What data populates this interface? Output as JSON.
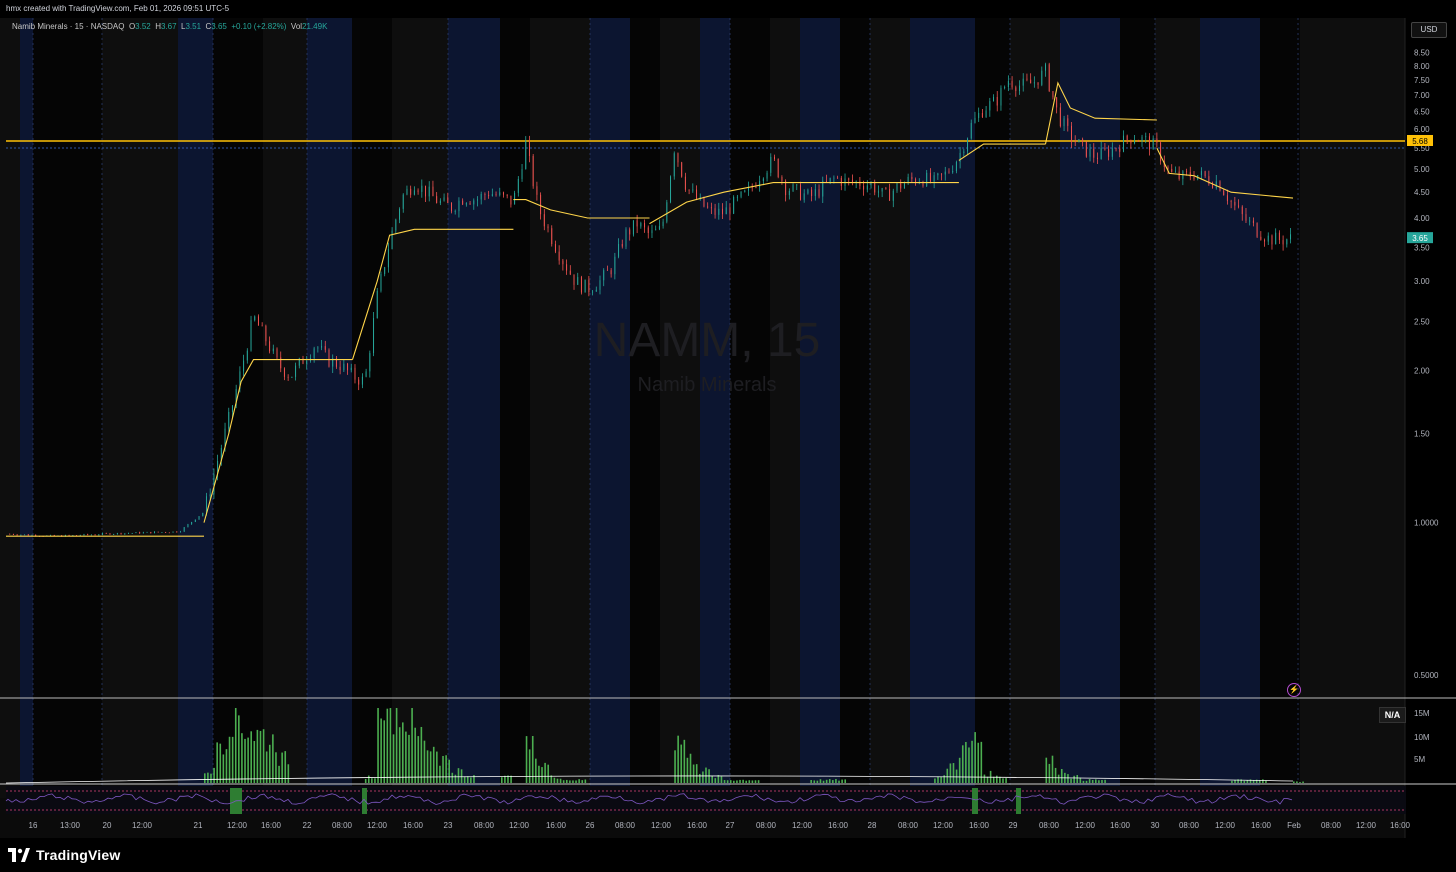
{
  "header": {
    "caption": "hmx created with TradingView.com, Feb 01, 2026 09:51 UTC-5"
  },
  "legend": {
    "symbol": "Namib Minerals · 15 · NASDAQ",
    "o_label": "O",
    "o": "3.52",
    "h_label": "H",
    "h": "3.67",
    "l_label": "L",
    "l": "3.51",
    "c_label": "C",
    "c": "3.65",
    "change": "+0.10 (+2.82%)",
    "vol_label": "Vol",
    "vol": "21.49K"
  },
  "currency_button": "USD",
  "watermark": {
    "ticker": "NAMM, 15",
    "name": "Namib Minerals"
  },
  "price_badges": {
    "level": "5.68",
    "last": "3.65"
  },
  "volume_badge": "N/A",
  "brand": {
    "name": "TradingView"
  },
  "colors": {
    "up": "#26a69a",
    "down": "#ef5350",
    "vwap": "#ffd54a",
    "level_line": "#ffc107",
    "last_badge": "#26a69a",
    "volume": "#4caf50",
    "session_blue": "#0c1530",
    "indicator": "#7e57c2"
  },
  "chart_data": {
    "type": "candlestick",
    "title": "Namib Minerals · 15 · NASDAQ",
    "y_scale": "log",
    "ylim": [
      0.45,
      9.5
    ],
    "y_ticks": [
      "8.50",
      "8.00",
      "7.50",
      "7.00",
      "6.50",
      "6.00",
      "5.50",
      "5.00",
      "4.50",
      "4.00",
      "3.50",
      "3.00",
      "2.50",
      "2.00",
      "1.50",
      "1.0000",
      "0.5000"
    ],
    "x_ticks": [
      "16",
      "13:00",
      "20",
      "12:00",
      "21",
      "12:00",
      "16:00",
      "22",
      "08:00",
      "12:00",
      "16:00",
      "23",
      "08:00",
      "12:00",
      "16:00",
      "26",
      "08:00",
      "12:00",
      "16:00",
      "27",
      "08:00",
      "12:00",
      "16:00",
      "28",
      "08:00",
      "12:00",
      "16:00",
      "29",
      "08:00",
      "12:00",
      "16:00",
      "30",
      "08:00",
      "12:00",
      "16:00",
      "Feb",
      "08:00",
      "12:00",
      "16:00"
    ],
    "horizontal_level": 5.68,
    "last_price": 3.65,
    "price_path": [
      [
        0,
        0.95
      ],
      [
        4,
        0.94
      ],
      [
        8,
        0.95
      ],
      [
        14,
        0.96
      ],
      [
        16,
        1.05
      ],
      [
        17,
        1.3
      ],
      [
        18,
        1.6
      ],
      [
        19,
        2.0
      ],
      [
        20,
        2.55
      ],
      [
        21,
        2.3
      ],
      [
        22,
        2.05
      ],
      [
        23,
        1.95
      ],
      [
        24,
        2.1
      ],
      [
        25,
        2.25
      ],
      [
        26,
        2.1
      ],
      [
        27,
        2.05
      ],
      [
        28,
        1.95
      ],
      [
        29,
        1.9
      ],
      [
        30,
        2.8
      ],
      [
        31,
        3.6
      ],
      [
        32,
        4.4
      ],
      [
        33,
        4.7
      ],
      [
        34,
        4.5
      ],
      [
        35,
        4.3
      ],
      [
        36,
        4.2
      ],
      [
        37,
        4.4
      ],
      [
        38,
        4.35
      ],
      [
        39,
        4.5
      ],
      [
        40,
        4.4
      ],
      [
        41,
        4.3
      ],
      [
        42,
        5.6
      ],
      [
        43,
        4.2
      ],
      [
        44,
        3.7
      ],
      [
        45,
        3.3
      ],
      [
        46,
        3.0
      ],
      [
        47,
        2.9
      ],
      [
        48,
        3.0
      ],
      [
        49,
        3.2
      ],
      [
        50,
        3.7
      ],
      [
        51,
        3.9
      ],
      [
        52,
        3.7
      ],
      [
        53,
        3.8
      ],
      [
        54,
        5.5
      ],
      [
        55,
        4.6
      ],
      [
        56,
        4.3
      ],
      [
        57,
        4.1
      ],
      [
        58,
        4.1
      ],
      [
        59,
        4.3
      ],
      [
        60,
        4.5
      ],
      [
        61,
        4.9
      ],
      [
        62,
        5.2
      ],
      [
        63,
        4.6
      ],
      [
        64,
        4.5
      ],
      [
        65,
        4.4
      ],
      [
        66,
        4.6
      ],
      [
        67,
        4.8
      ],
      [
        68,
        4.7
      ],
      [
        69,
        4.7
      ],
      [
        70,
        4.65
      ],
      [
        71,
        4.4
      ],
      [
        72,
        4.6
      ],
      [
        73,
        4.75
      ],
      [
        74,
        4.8
      ],
      [
        75,
        4.7
      ],
      [
        76,
        4.9
      ],
      [
        77,
        5.3
      ],
      [
        78,
        6.1
      ],
      [
        79,
        6.6
      ],
      [
        80,
        6.8
      ],
      [
        81,
        7.5
      ],
      [
        82,
        7.3
      ],
      [
        83,
        7.4
      ],
      [
        84,
        7.8
      ],
      [
        85,
        6.4
      ],
      [
        86,
        5.8
      ],
      [
        87,
        5.5
      ],
      [
        88,
        5.3
      ],
      [
        89,
        5.4
      ],
      [
        90,
        5.6
      ],
      [
        91,
        5.8
      ],
      [
        92,
        5.7
      ],
      [
        93,
        5.5
      ],
      [
        94,
        4.9
      ],
      [
        95,
        4.8
      ],
      [
        96,
        4.9
      ],
      [
        97,
        4.8
      ],
      [
        98,
        4.7
      ],
      [
        99,
        4.3
      ],
      [
        100,
        4.0
      ],
      [
        101,
        3.8
      ],
      [
        102,
        3.65
      ],
      [
        103,
        3.62
      ],
      [
        104,
        3.65
      ]
    ],
    "vwap_segments": [
      [
        [
          0,
          0.94
        ],
        [
          16,
          0.94
        ]
      ],
      [
        [
          16,
          1.0
        ],
        [
          18,
          1.5
        ],
        [
          19,
          1.9
        ],
        [
          20,
          2.1
        ],
        [
          28,
          2.1
        ]
      ],
      [
        [
          28,
          2.1
        ],
        [
          30,
          3.0
        ],
        [
          31,
          3.7
        ],
        [
          33,
          3.8
        ],
        [
          41,
          3.8
        ]
      ],
      [
        [
          41,
          4.35
        ],
        [
          42,
          4.35
        ],
        [
          44,
          4.15
        ],
        [
          47,
          4.0
        ],
        [
          52,
          4.0
        ]
      ],
      [
        [
          52,
          3.9
        ],
        [
          55,
          4.3
        ],
        [
          58,
          4.5
        ],
        [
          62,
          4.7
        ],
        [
          77,
          4.7
        ]
      ],
      [
        [
          77,
          5.2
        ],
        [
          79,
          5.6
        ],
        [
          84,
          5.6
        ]
      ],
      [
        [
          84,
          5.6
        ],
        [
          85,
          7.4
        ],
        [
          86,
          6.6
        ],
        [
          88,
          6.3
        ],
        [
          93,
          6.25
        ]
      ],
      [
        [
          93,
          5.5
        ],
        [
          94,
          4.9
        ],
        [
          96,
          4.85
        ],
        [
          99,
          4.5
        ],
        [
          104,
          4.38
        ]
      ]
    ],
    "volume_series": {
      "name": "Volume",
      "values": [
        0,
        0,
        0,
        0,
        0,
        0,
        0,
        0,
        0,
        0,
        0,
        0,
        0,
        0,
        0,
        0,
        0.2,
        0.7,
        1.1,
        0.9,
        0.8,
        0.7,
        0.4,
        0,
        0,
        0,
        0,
        0,
        0,
        0.1,
        1.5,
        1.2,
        1.0,
        0.8,
        0.6,
        0.4,
        0.2,
        0.1,
        0,
        0,
        0.1,
        0,
        0.6,
        0.3,
        0.1,
        0.05,
        0.05,
        0,
        0,
        0,
        0,
        0,
        0,
        0,
        0.7,
        0.4,
        0.2,
        0.1,
        0.05,
        0.05,
        0.05,
        0,
        0,
        0,
        0,
        0.05,
        0.05,
        0.05,
        0,
        0,
        0,
        0,
        0,
        0,
        0,
        0.1,
        0.3,
        0.55,
        0.7,
        0.15,
        0.1,
        0,
        0,
        0,
        0.35,
        0.2,
        0.1,
        0.05,
        0.05,
        0,
        0,
        0,
        0,
        0,
        0,
        0,
        0,
        0,
        0,
        0.05,
        0.05,
        0.05,
        0,
        0,
        0.02
      ]
    },
    "volume_ticks": [
      "15M",
      "10M",
      "5M"
    ]
  }
}
